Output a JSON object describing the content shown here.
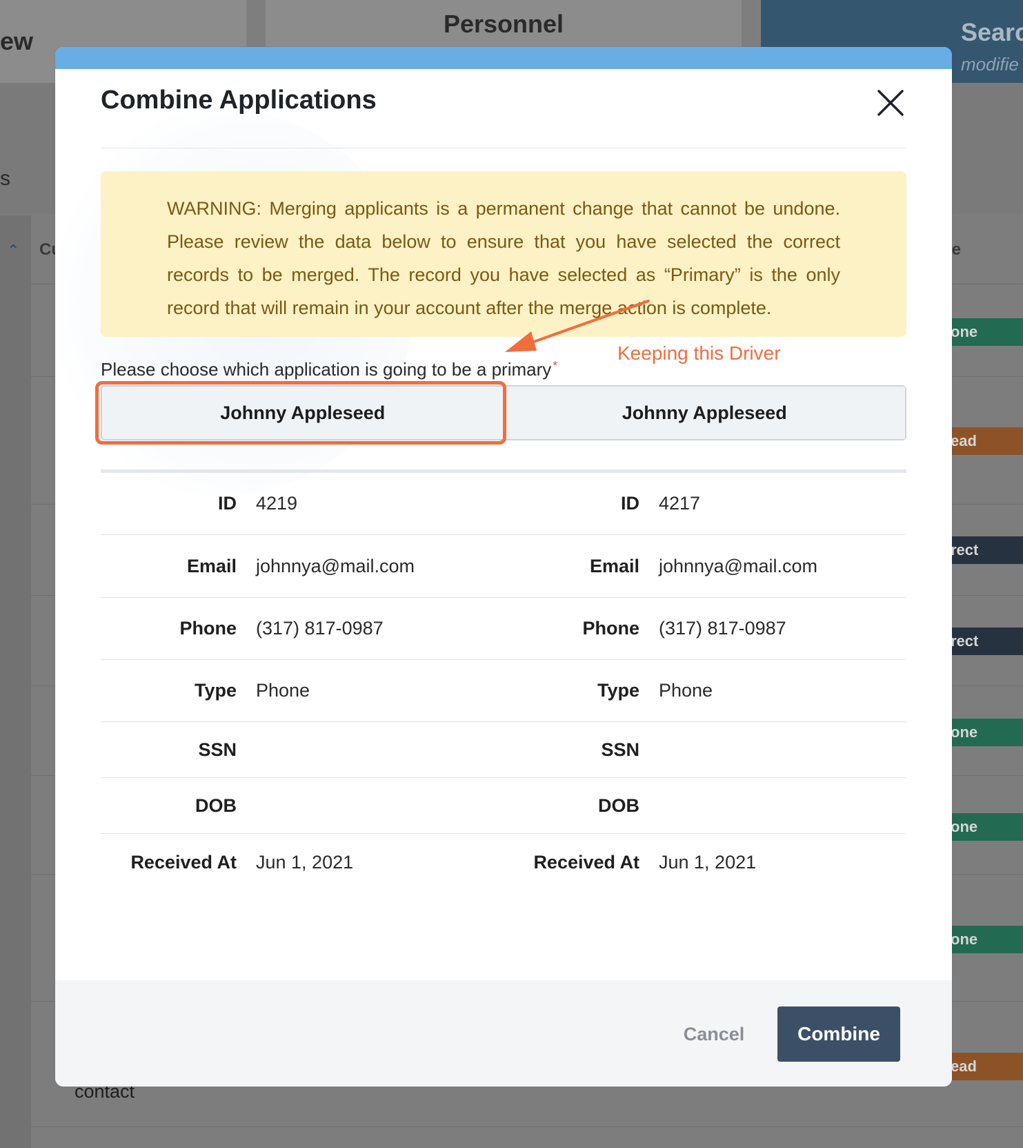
{
  "background": {
    "tabs": [
      "ew",
      "Personnel",
      "Searc"
    ],
    "search_tab_subtitle": "modifie",
    "toolbar_fragment": "s",
    "list_header_left": "Cu",
    "list_header_right": "pe",
    "badges": [
      "one",
      "ead",
      "rect",
      "rect",
      "one",
      "one",
      "one",
      "ead"
    ],
    "contact_fragment": "contact"
  },
  "modal": {
    "title": "Combine Applications",
    "warning": "WARNING: Merging applicants is a permanent change that cannot be undone. Please review the data below to ensure that you have selected the correct records to be merged. The record you have selected as “Primary” is the only record that will remain in your account after the merge action is complete.",
    "choose_label": "Please choose which application is going to be a primary",
    "required_marker": "*",
    "annotation": "Keeping this Driver",
    "choices": [
      "Johnny Appleseed",
      "Johnny Appleseed"
    ],
    "fields": [
      {
        "label": "ID",
        "left": "4219",
        "right": "4217"
      },
      {
        "label": "Email",
        "left": "johnnya@mail.com",
        "right": "johnnya@mail.com"
      },
      {
        "label": "Phone",
        "left": "(317) 817-0987",
        "right": "(317) 817-0987"
      },
      {
        "label": "Type",
        "left": "Phone",
        "right": "Phone"
      },
      {
        "label": "SSN",
        "left": "",
        "right": ""
      },
      {
        "label": "DOB",
        "left": "",
        "right": ""
      },
      {
        "label": "Received At",
        "left": "Jun 1, 2021",
        "right": "Jun 1, 2021"
      }
    ],
    "cancel_label": "Cancel",
    "combine_label": "Combine"
  },
  "colors": {
    "modal_top_bar": "#68ade4",
    "warning_bg": "#fdf1c6",
    "warning_text": "#7a5a12",
    "annotation": "#f26d3d",
    "combine_bg": "#3b5066"
  }
}
